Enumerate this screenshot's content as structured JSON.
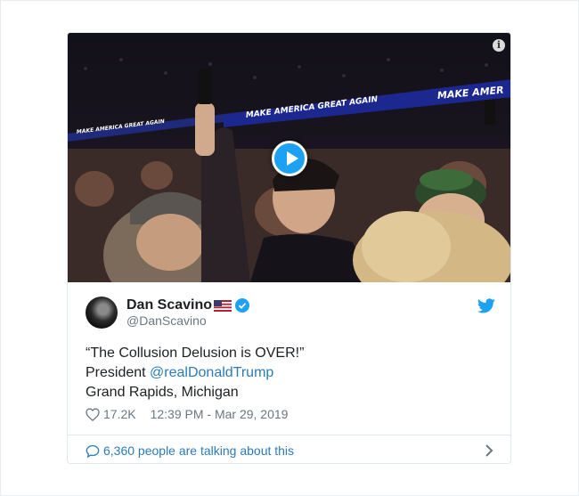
{
  "media": {
    "banner_main": "MAKE AMERICA GREAT AGAIN",
    "banner_left": "MAKE AMERICA GREAT AGAIN",
    "banner_right": "MAKE AMER",
    "info_icon": "info-icon",
    "play_icon": "play-icon"
  },
  "author": {
    "display_name": "Dan Scavino",
    "handle": "@DanScavino",
    "flag_icon": "us-flag-icon",
    "verified_icon": "verified-badge-icon"
  },
  "tweet": {
    "line1": "“The Collusion Delusion is OVER!”",
    "line2_prefix": "President ",
    "line2_mention": "@realDonaldTrump",
    "line3": "Grand Rapids, Michigan"
  },
  "meta": {
    "likes": "17.2K",
    "timestamp": "12:39 PM - Mar 29, 2019"
  },
  "footer": {
    "talking": "6,360 people are talking about this"
  },
  "colors": {
    "twitter_blue": "#1da1f2",
    "link_blue": "#2b7bb9",
    "secondary_text": "#697882",
    "border": "#e1e8ed"
  }
}
